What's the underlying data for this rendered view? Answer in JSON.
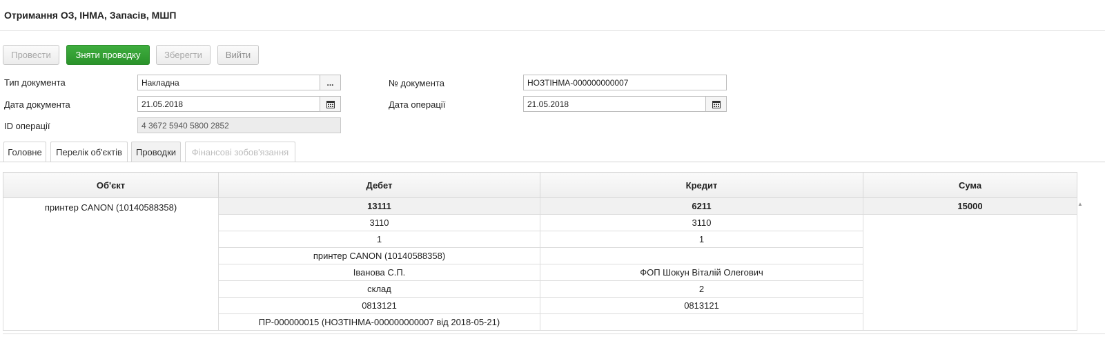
{
  "page": {
    "title": "Отримання ОЗ, ІНМА, Запасів, МШП"
  },
  "toolbar": {
    "post_label": "Провести",
    "unpost_label": "Зняти проводку",
    "save_label": "Зберегти",
    "exit_label": "Вийти"
  },
  "form": {
    "doc_type": {
      "label": "Тип документа",
      "value": "Накладна",
      "button": "..."
    },
    "doc_number": {
      "label": "№ документа",
      "value": "НОЗТІНМА-000000000007"
    },
    "doc_date": {
      "label": "Дата документа",
      "value": "21.05.2018"
    },
    "op_date": {
      "label": "Дата операції",
      "value": "21.05.2018"
    },
    "op_id": {
      "label": "ID операції",
      "value": "4 3672 5940 5800 2852"
    }
  },
  "tabs": [
    {
      "label": "Головне"
    },
    {
      "label": "Перелік об'єктів"
    },
    {
      "label": "Проводки"
    },
    {
      "label": "Фінансові зобов'язання"
    }
  ],
  "grid": {
    "headers": [
      "Об'єкт",
      "Дебет",
      "Кредит",
      "Сума"
    ],
    "object": "принтер CANON (10140588358)",
    "sum": "15000",
    "rows": [
      {
        "debit": "13111",
        "credit": "6211"
      },
      {
        "debit": "3110",
        "credit": "3110"
      },
      {
        "debit": "1",
        "credit": "1"
      },
      {
        "debit": "принтер CANON (10140588358)",
        "credit": ""
      },
      {
        "debit": "Іванова С.П.",
        "credit": "ФОП Шокун Віталій Олегович"
      },
      {
        "debit": "склад",
        "credit": "2"
      },
      {
        "debit": "0813121",
        "credit": "0813121"
      },
      {
        "debit": "ПР-000000015 (НОЗТІНМА-000000000007 від 2018-05-21)",
        "credit": ""
      }
    ]
  },
  "icons": {
    "calendar": "calendar-icon",
    "scroll_up": "scroll-up-icon"
  },
  "colors": {
    "primary_button": "#2e9a2e",
    "border": "#d3d3d3"
  }
}
